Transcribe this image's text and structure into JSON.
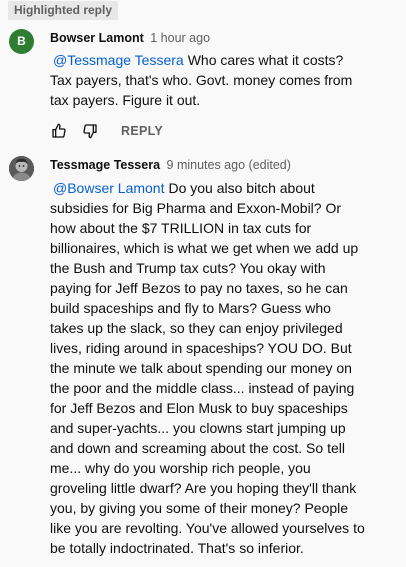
{
  "highlighted_label": "Highlighted reply",
  "comments": [
    {
      "avatar_letter": "B",
      "author": "Bowser Lamont",
      "time": "1 hour ago",
      "edited": "",
      "mention": "@Tessmage Tessera",
      "text": "Who cares what it costs? Tax payers, that's who. Govt. money comes from tax payers. Figure it out.",
      "reply_label": "REPLY"
    },
    {
      "author": "Tessmage Tessera",
      "time": "9 minutes ago",
      "edited": "(edited)",
      "mention": "@Bowser Lamont",
      "text": "Do you also bitch about subsidies for Big Pharma and Exxon-Mobil? Or how about the $7 TRILLION in tax cuts for billionaires, which is what we get when we add up the Bush and Trump tax cuts? You okay with paying for Jeff Bezos to pay no taxes, so he can build spaceships and fly to Mars? Guess who takes up the slack, so they can enjoy privileged lives, riding around in spaceships? YOU DO. But the minute we talk about spending our money on the poor and the middle class... instead of paying for Jeff Bezos and Elon Musk to buy spaceships and super-yachts... you clowns start jumping up and down and screaming about the cost. So tell me... why do you worship rich people, you groveling little dwarf? Are you hoping they'll thank you, by giving you some of their money? People like you are revolting. You've allowed yourselves to be totally indoctrinated. That's so inferior."
    }
  ],
  "colors": {
    "background": "#f9f9f9",
    "mention": "#065fd4",
    "avatar_b": "#2e7d32",
    "secondary_text": "#606060"
  },
  "icons": [
    "thumbs-up-icon",
    "thumbs-down-icon"
  ]
}
